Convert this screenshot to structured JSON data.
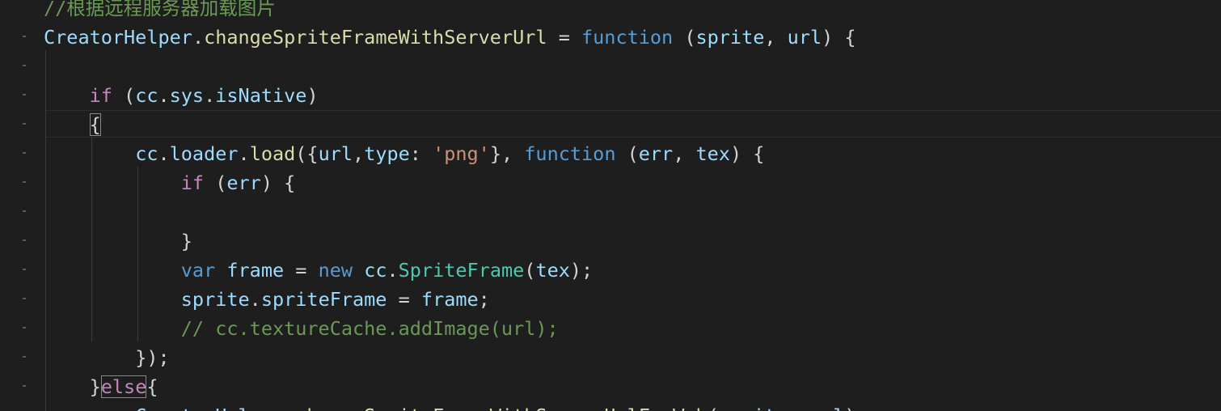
{
  "editor": {
    "lines": [
      {
        "id": "l0",
        "tokens": [
          {
            "t": "//根据远程服务器加载图片",
            "c": "cmt"
          }
        ]
      },
      {
        "id": "l1",
        "tokens": [
          {
            "t": "CreatorHelper",
            "c": "var"
          },
          {
            "t": ".",
            "c": "punc"
          },
          {
            "t": "changeSpriteFrameWithServerUrl",
            "c": "fn"
          },
          {
            "t": " = ",
            "c": "punc"
          },
          {
            "t": "function",
            "c": "blue"
          },
          {
            "t": " (",
            "c": "punc"
          },
          {
            "t": "sprite",
            "c": "var"
          },
          {
            "t": ", ",
            "c": "punc"
          },
          {
            "t": "url",
            "c": "var"
          },
          {
            "t": ") {",
            "c": "punc"
          }
        ]
      },
      {
        "id": "l2",
        "tokens": []
      },
      {
        "id": "l3",
        "tokens": [
          {
            "t": "    ",
            "c": "punc"
          },
          {
            "t": "if",
            "c": "kw"
          },
          {
            "t": " (",
            "c": "punc"
          },
          {
            "t": "cc",
            "c": "var"
          },
          {
            "t": ".",
            "c": "punc"
          },
          {
            "t": "sys",
            "c": "var"
          },
          {
            "t": ".",
            "c": "punc"
          },
          {
            "t": "isNative",
            "c": "var"
          },
          {
            "t": ")",
            "c": "punc"
          }
        ]
      },
      {
        "id": "l4",
        "tokens": [
          {
            "t": "    ",
            "c": "punc"
          },
          {
            "t": "{",
            "c": "punc",
            "box": true
          }
        ]
      },
      {
        "id": "l5",
        "tokens": [
          {
            "t": "        ",
            "c": "punc"
          },
          {
            "t": "cc",
            "c": "var"
          },
          {
            "t": ".",
            "c": "punc"
          },
          {
            "t": "loader",
            "c": "var"
          },
          {
            "t": ".",
            "c": "punc"
          },
          {
            "t": "load",
            "c": "fn"
          },
          {
            "t": "({",
            "c": "punc"
          },
          {
            "t": "url",
            "c": "var"
          },
          {
            "t": ",",
            "c": "punc"
          },
          {
            "t": "type",
            "c": "var"
          },
          {
            "t": ": ",
            "c": "punc"
          },
          {
            "t": "'png'",
            "c": "str"
          },
          {
            "t": "}, ",
            "c": "punc"
          },
          {
            "t": "function",
            "c": "blue"
          },
          {
            "t": " (",
            "c": "punc"
          },
          {
            "t": "err",
            "c": "var"
          },
          {
            "t": ", ",
            "c": "punc"
          },
          {
            "t": "tex",
            "c": "var"
          },
          {
            "t": ") {",
            "c": "punc"
          }
        ]
      },
      {
        "id": "l6",
        "tokens": [
          {
            "t": "            ",
            "c": "punc"
          },
          {
            "t": "if",
            "c": "kw"
          },
          {
            "t": " (",
            "c": "punc"
          },
          {
            "t": "err",
            "c": "var"
          },
          {
            "t": ") {",
            "c": "punc"
          }
        ]
      },
      {
        "id": "l7",
        "tokens": []
      },
      {
        "id": "l8",
        "tokens": [
          {
            "t": "            ",
            "c": "punc"
          },
          {
            "t": "}",
            "c": "punc"
          }
        ]
      },
      {
        "id": "l9",
        "tokens": [
          {
            "t": "            ",
            "c": "punc"
          },
          {
            "t": "var",
            "c": "blue"
          },
          {
            "t": " ",
            "c": "punc"
          },
          {
            "t": "frame",
            "c": "var"
          },
          {
            "t": " = ",
            "c": "punc"
          },
          {
            "t": "new",
            "c": "blue"
          },
          {
            "t": " ",
            "c": "punc"
          },
          {
            "t": "cc",
            "c": "var"
          },
          {
            "t": ".",
            "c": "punc"
          },
          {
            "t": "SpriteFrame",
            "c": "type"
          },
          {
            "t": "(",
            "c": "punc"
          },
          {
            "t": "tex",
            "c": "var"
          },
          {
            "t": ");",
            "c": "punc"
          }
        ]
      },
      {
        "id": "l10",
        "tokens": [
          {
            "t": "            ",
            "c": "punc"
          },
          {
            "t": "sprite",
            "c": "var"
          },
          {
            "t": ".",
            "c": "punc"
          },
          {
            "t": "spriteFrame",
            "c": "var"
          },
          {
            "t": " = ",
            "c": "punc"
          },
          {
            "t": "frame",
            "c": "var"
          },
          {
            "t": ";",
            "c": "punc"
          }
        ]
      },
      {
        "id": "l11",
        "tokens": [
          {
            "t": "            ",
            "c": "punc"
          },
          {
            "t": "// cc.textureCache.addImage(url);",
            "c": "cmt"
          }
        ]
      },
      {
        "id": "l12",
        "tokens": [
          {
            "t": "        ",
            "c": "punc"
          },
          {
            "t": "});",
            "c": "punc"
          }
        ]
      },
      {
        "id": "l13",
        "tokens": [
          {
            "t": "    ",
            "c": "punc"
          },
          {
            "t": "}",
            "c": "punc"
          },
          {
            "t": "else",
            "c": "kw",
            "box": true
          },
          {
            "t": "{",
            "c": "punc"
          }
        ]
      },
      {
        "id": "l14",
        "tokens": [
          {
            "t": "        ",
            "c": "punc"
          },
          {
            "t": "CreatorHelper",
            "c": "var"
          },
          {
            "t": ".",
            "c": "punc"
          },
          {
            "t": "changeSpriteFrameWithServerUrlForWeb",
            "c": "fn"
          },
          {
            "t": "(",
            "c": "punc"
          },
          {
            "t": "sprite",
            "c": "var"
          },
          {
            "t": ", ",
            "c": "punc"
          },
          {
            "t": "url",
            "c": "var"
          },
          {
            "t": ");",
            "c": "punc"
          }
        ]
      }
    ]
  }
}
